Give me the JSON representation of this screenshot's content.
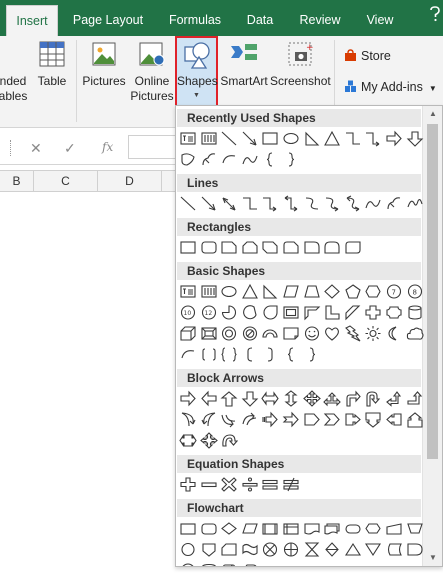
{
  "ribbon": {
    "tabs": [
      {
        "label": "Insert",
        "active": true
      },
      {
        "label": "Page Layout",
        "active": false
      },
      {
        "label": "Formulas",
        "active": false
      },
      {
        "label": "Data",
        "active": false
      },
      {
        "label": "Review",
        "active": false
      },
      {
        "label": "View",
        "active": false
      }
    ],
    "help_icon": "help-icon",
    "buttons": {
      "recommended_line1": "nded",
      "recommended_line2": "ables",
      "table": "Table",
      "pictures": "Pictures",
      "online_pictures_line1": "Online",
      "online_pictures_line2": "Pictures",
      "shapes": "Shapes",
      "smartart": "SmartArt",
      "screenshot": "Screenshot",
      "store": "Store",
      "my_addins": "My Add-ins"
    }
  },
  "formula_bar": {
    "cancel_icon": "✕",
    "enter_icon": "✓",
    "fx_icon": "fx"
  },
  "columns": [
    "B",
    "C",
    "D"
  ],
  "gallery": {
    "sections": [
      {
        "title": "Recently Used Shapes",
        "rows": [
          [
            "textbox",
            "vtextbox",
            "line",
            "arrow",
            "rect",
            "oval",
            "rtriangle",
            "triangle",
            "elbow",
            "elbowarrow",
            "rightarrow",
            "downarrow"
          ],
          [
            "curvedshape",
            "freeform",
            "arc",
            "curve",
            "lbrace",
            "rbrace"
          ]
        ]
      },
      {
        "title": "Lines",
        "rows": [
          [
            "line",
            "arrow",
            "dblarrow",
            "elbow",
            "elbowarrow",
            "elbowdblarrow",
            "curvedconn",
            "curvedarrow",
            "curveddblarrow",
            "curve",
            "freeform",
            "scribble"
          ]
        ]
      },
      {
        "title": "Rectangles",
        "rows": [
          [
            "rect",
            "roundrect",
            "snip1",
            "snip2",
            "snip3",
            "snipround1",
            "round1",
            "round2",
            "roundsame"
          ]
        ]
      },
      {
        "title": "Basic Shapes",
        "rows": [
          [
            "textbox",
            "vtextbox",
            "oval",
            "triangle",
            "rtriangle",
            "parallelogram",
            "trapezoid",
            "diamond",
            "pentagon",
            "hexagon",
            "heptagon",
            "octagon"
          ],
          [
            "decagon",
            "dodecagon",
            "pie",
            "chord",
            "teardrop",
            "frame",
            "halfframe",
            "lshape",
            "diagstripe",
            "cross",
            "plaque",
            "can"
          ],
          [
            "cube",
            "bevel",
            "donut",
            "nosymbol",
            "blockarc",
            "foldedcorner",
            "smiley",
            "heart",
            "lightning",
            "sun",
            "moon",
            "cloud"
          ],
          [
            "arc",
            "dblbracket",
            "dblbrace",
            "lbracket",
            "rbracket",
            "lbrace",
            "rbrace"
          ]
        ]
      },
      {
        "title": "Block Arrows",
        "rows": [
          [
            "rightarrow",
            "leftarrow",
            "uparrow",
            "downarrow",
            "lrarrow",
            "udarrow",
            "quadarrow",
            "lrudarrow",
            "bentarrow",
            "uturn",
            "luarrow",
            "bentuparrow"
          ],
          [
            "curvedright",
            "curvedleft",
            "curvedup",
            "curveddown",
            "stripedright",
            "notchedright",
            "pentagonarrow",
            "chevron",
            "rightcallout",
            "downcallout",
            "leftcallout",
            "upcallout"
          ],
          [
            "lrcallout",
            "quadcallout",
            "circulararrow"
          ]
        ]
      },
      {
        "title": "Equation Shapes",
        "rows": [
          [
            "plus",
            "minus",
            "multiply",
            "divide",
            "equal",
            "notequal"
          ]
        ]
      },
      {
        "title": "Flowchart",
        "rows": [
          [
            "fc-process",
            "fc-altprocess",
            "fc-decision",
            "fc-data",
            "fc-predefined",
            "fc-internal",
            "fc-document",
            "fc-multidoc",
            "fc-terminator",
            "fc-preparation",
            "fc-manualinput",
            "fc-manualop"
          ],
          [
            "fc-connector",
            "fc-offpage",
            "fc-card",
            "fc-punchtape",
            "fc-sumjunction",
            "fc-or",
            "fc-collate",
            "fc-sort",
            "fc-extract",
            "fc-merge",
            "fc-storeddata",
            "fc-delay"
          ],
          [
            "fc-seqaccess",
            "fc-magdisk",
            "fc-directaccess",
            "fc-display"
          ]
        ]
      }
    ]
  }
}
